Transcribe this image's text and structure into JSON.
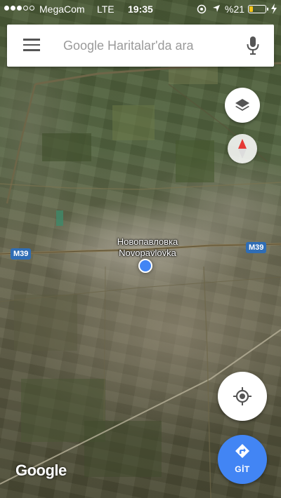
{
  "status_bar": {
    "carrier": "MegaCom",
    "network": "LTE",
    "time": "19:35",
    "battery_percent": "%21",
    "signal_bars_filled": 3,
    "signal_bars_total": 5,
    "battery_level": 0.21,
    "icons": [
      "location-status-icon",
      "navigation-arrow-icon",
      "battery-icon",
      "charging-icon"
    ]
  },
  "search": {
    "placeholder": "Google Haritalar'da ara",
    "menu_icon": "hamburger-menu-icon",
    "voice_icon": "microphone-icon"
  },
  "map": {
    "type": "satellite",
    "city_label_cyrillic": "Новопавловка",
    "city_label_latin": "Novopavlovka",
    "road_shields": [
      "M39",
      "M39"
    ],
    "attribution": "Google"
  },
  "controls": {
    "layers_icon": "layers-icon",
    "compass_icon": "compass-icon",
    "my_location_icon": "my-location-icon",
    "directions_label": "GİT",
    "directions_icon": "directions-arrow-icon"
  },
  "colors": {
    "accent_blue": "#4285f4",
    "road_shield_blue": "#2f6db5",
    "compass_red": "#e53935",
    "battery_yellow": "#f5c518"
  }
}
